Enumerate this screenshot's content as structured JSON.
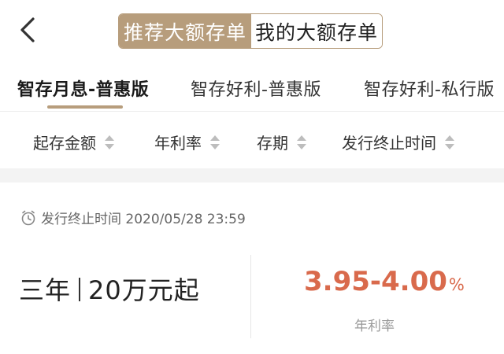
{
  "header": {
    "back_icon": "chevron-left-icon",
    "segments": [
      {
        "label": "推荐大额存单",
        "active": true
      },
      {
        "label": "我的大额存单",
        "active": false
      }
    ]
  },
  "tabs": [
    {
      "label": "智存月息-普惠版",
      "active": true
    },
    {
      "label": "智存好利-普惠版",
      "active": false
    },
    {
      "label": "智存好利-私行版",
      "active": false
    }
  ],
  "filters": [
    {
      "label": "起存金额",
      "icon": "sort-icon"
    },
    {
      "label": "年利率",
      "icon": "sort-icon"
    },
    {
      "label": "存期",
      "icon": "sort-icon"
    },
    {
      "label": "发行终止时间",
      "icon": "sort-icon"
    }
  ],
  "product": {
    "deadline_icon": "clock-icon",
    "deadline": "发行终止时间 2020/05/28 23:59",
    "term": "三年",
    "min_amount": "20万元起",
    "rate": "3.95-4.00",
    "rate_unit": "%",
    "rate_label": "年利率"
  },
  "colors": {
    "accent": "#b79d7c",
    "rate": "#d96a4c",
    "divider": "#f3f3f3"
  }
}
